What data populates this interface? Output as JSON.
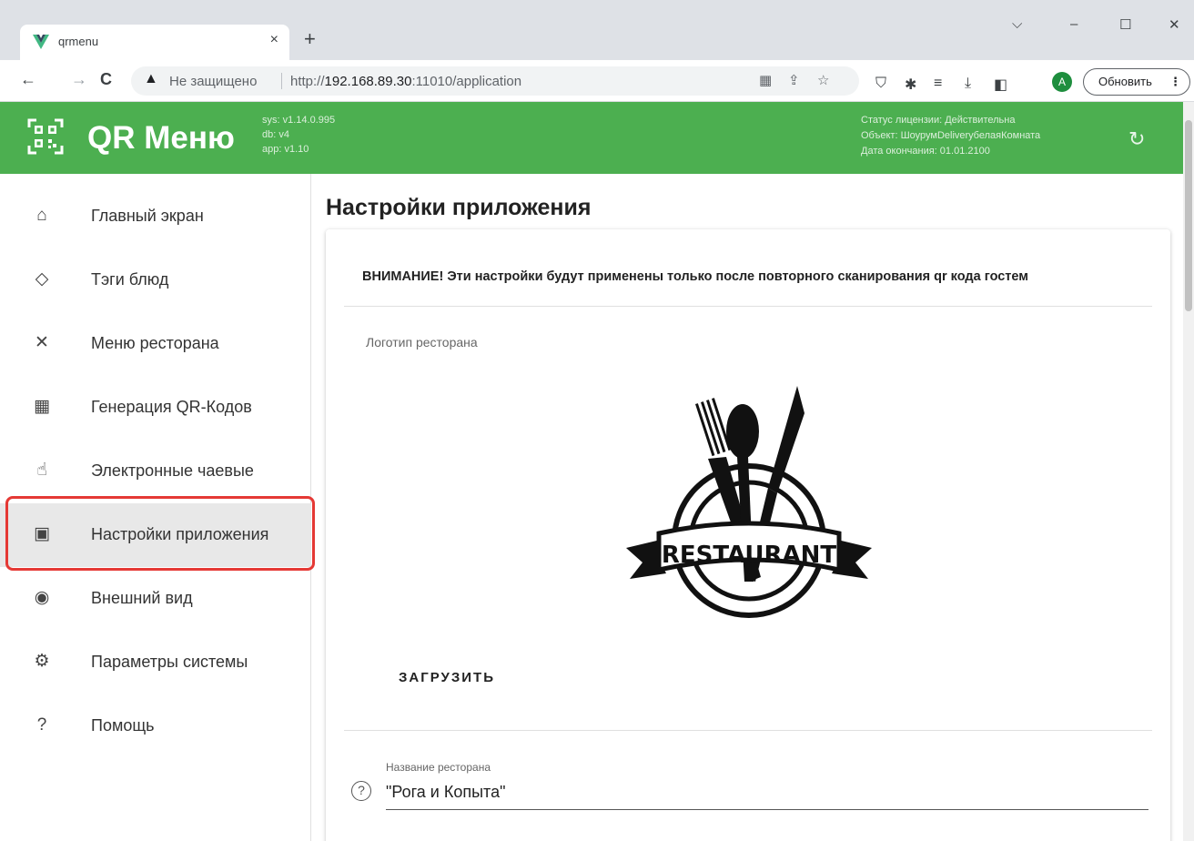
{
  "browser": {
    "tab_title": "qrmenu",
    "tab_close": "×",
    "new_tab": "+",
    "win_minimize": "–",
    "win_maximize": "☐",
    "win_close": "✕",
    "win_menu": "⌵",
    "back": "←",
    "forward": "→",
    "reload": "C",
    "insecure_label": "Не защищено",
    "url_prefix": "http://",
    "url_host": "192.168.89.30",
    "url_rest": ":11010/application",
    "avatar_letter": "A",
    "update_label": "Обновить",
    "update_menu": "⋮"
  },
  "header": {
    "brand": "QR Меню",
    "sys_version": "sys: v1.14.0.995",
    "db_version": "db: v4",
    "app_version": "app: v1.10",
    "license_status": "Статус лицензии: Действительна",
    "license_object": "Объект: ШоурумDeliveryбелаяКомната",
    "license_end": "Дата окончания: 01.01.2100"
  },
  "sidebar": {
    "items": [
      {
        "label": "Главный экран",
        "icon": "home-icon"
      },
      {
        "label": "Тэги блюд",
        "icon": "tag-icon"
      },
      {
        "label": "Меню ресторана",
        "icon": "utensils-icon"
      },
      {
        "label": "Генерация QR-Кодов",
        "icon": "qr-icon"
      },
      {
        "label": "Электронные чаевые",
        "icon": "tip-icon"
      },
      {
        "label": "Настройки приложения",
        "icon": "app-settings-icon"
      },
      {
        "label": "Внешний вид",
        "icon": "eye-icon"
      },
      {
        "label": "Параметры системы",
        "icon": "gear-icon"
      },
      {
        "label": "Помощь",
        "icon": "help-icon"
      }
    ],
    "active_index": 5
  },
  "main": {
    "title": "Настройки приложения",
    "warning": "ВНИМАНИЕ! Эти настройки будут применены только после повторного сканирования qr кода гостем",
    "logo_label": "Логотип ресторана",
    "logo_text": "RESTAURANT",
    "upload_label": "ЗАГРУЗИТЬ",
    "name_field": {
      "label": "Название ресторана",
      "value": "\"Рога и Копыта\"",
      "help": "?"
    }
  },
  "colors": {
    "header_green": "#4caf50",
    "highlight_red": "#e53935"
  }
}
